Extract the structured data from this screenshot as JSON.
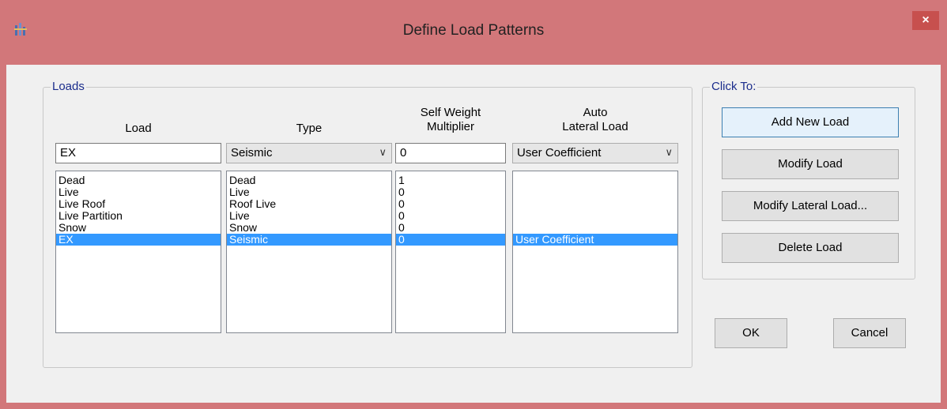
{
  "window": {
    "title": "Define Load Patterns",
    "close": "×"
  },
  "loads_group": {
    "label": "Loads",
    "headers": {
      "load": "Load",
      "type": "Type",
      "self_weight": [
        "Self Weight",
        "Multiplier"
      ],
      "auto_lateral": [
        "Auto",
        "Lateral Load"
      ]
    },
    "inputs": {
      "load": "EX",
      "type": "Seismic",
      "self_weight": "0",
      "auto_lateral": "User Coefficient"
    },
    "rows": [
      {
        "load": "Dead",
        "type": "Dead",
        "self_weight": "1",
        "auto_lateral": ""
      },
      {
        "load": "Live",
        "type": "Live",
        "self_weight": "0",
        "auto_lateral": ""
      },
      {
        "load": "Live Roof",
        "type": "Roof Live",
        "self_weight": "0",
        "auto_lateral": ""
      },
      {
        "load": "Live Partition",
        "type": "Live",
        "self_weight": "0",
        "auto_lateral": ""
      },
      {
        "load": "Snow",
        "type": "Snow",
        "self_weight": "0",
        "auto_lateral": ""
      },
      {
        "load": "EX",
        "type": "Seismic",
        "self_weight": "0",
        "auto_lateral": "User Coefficient",
        "selected": true
      }
    ]
  },
  "click_to_group": {
    "label": "Click To:",
    "buttons": {
      "add": "Add New Load",
      "modify": "Modify Load",
      "modify_lateral": "Modify Lateral Load...",
      "delete": "Delete Load"
    }
  },
  "footer": {
    "ok": "OK",
    "cancel": "Cancel"
  },
  "colors": {
    "title_bar": "#d2777a",
    "selection": "#3399ff",
    "group_label": "#1a2c8c",
    "close_button": "#c7504e"
  },
  "icons": {
    "app": "app-icon",
    "dropdown": "chevron-down-icon"
  }
}
